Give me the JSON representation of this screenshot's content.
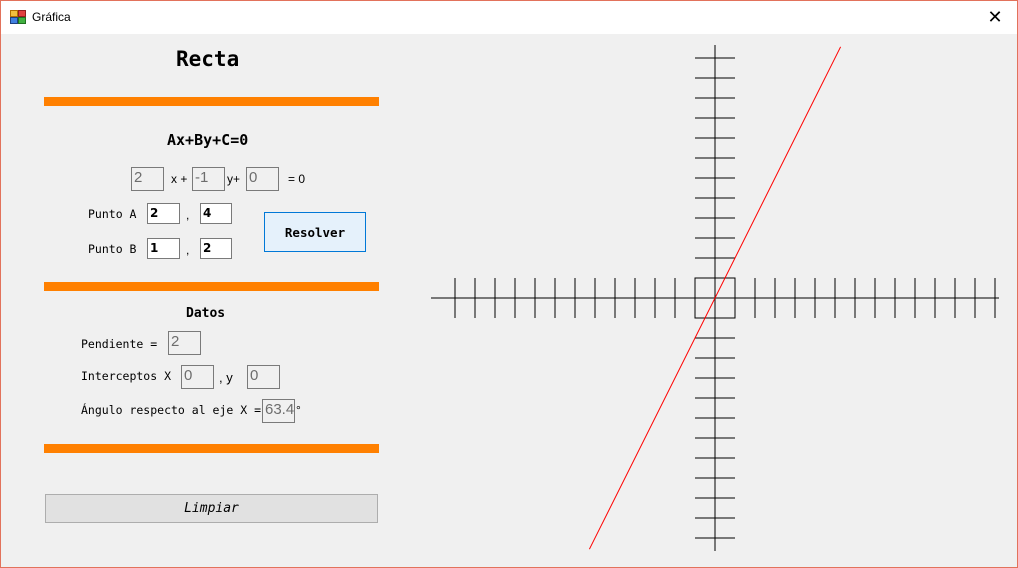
{
  "window": {
    "title": "Gráfica",
    "close_glyph": "✕"
  },
  "heading": "Recta",
  "equation": {
    "general_form": "Ax+By+C=0",
    "a_value": "2",
    "x_label": "x +",
    "b_value": "-1",
    "y_label": "y+",
    "c_value": "0",
    "equals_label": "= 0"
  },
  "points": {
    "a_label": "Punto A",
    "a_x": "2",
    "a_y": "4",
    "b_label": "Punto B",
    "b_x": "1",
    "b_y": "2",
    "separator": ","
  },
  "resolver_label": "Resolver",
  "datos": {
    "title": "Datos",
    "pendiente_label": "Pendiente =",
    "pendiente_value": "2",
    "interceptos_label": "Interceptos X",
    "intercept_x_value": "0",
    "intercept_y_label": ", y",
    "intercept_y_value": "0",
    "angulo_label": "Ángulo respecto al eje X =",
    "angulo_value": "63.4",
    "degree_symbol": "°"
  },
  "limpiar_label": "Limpiar",
  "chart_data": {
    "type": "line",
    "line": {
      "slope": 2,
      "intercept": 0,
      "color": "#ff0000"
    },
    "axes_color": "#000000"
  }
}
